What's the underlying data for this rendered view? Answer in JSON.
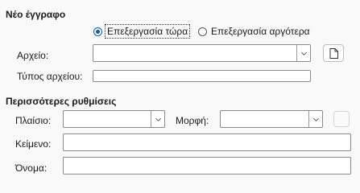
{
  "new_document": {
    "title": "Νέο έγγραφο",
    "options": [
      {
        "label": "Επεξεργασία τώρα",
        "selected": true
      },
      {
        "label": "Επεξεργασία αργότερα",
        "selected": false
      }
    ],
    "file_label": "Αρχείο:",
    "file_value": "",
    "file_type_label": "Τύπος αρχείου:",
    "file_type_value": ""
  },
  "more_settings": {
    "title": "Περισσότερες ρυθμίσεις",
    "frame_label": "Πλαίσιο:",
    "frame_value": "",
    "format_label": "Μορφή:",
    "format_value": "",
    "text_label": "Κείμενο:",
    "text_value": "",
    "name_label": "Όνομα:",
    "name_value": ""
  },
  "icons": {
    "dropdown": "chevron-down-icon",
    "browse": "document-icon"
  }
}
